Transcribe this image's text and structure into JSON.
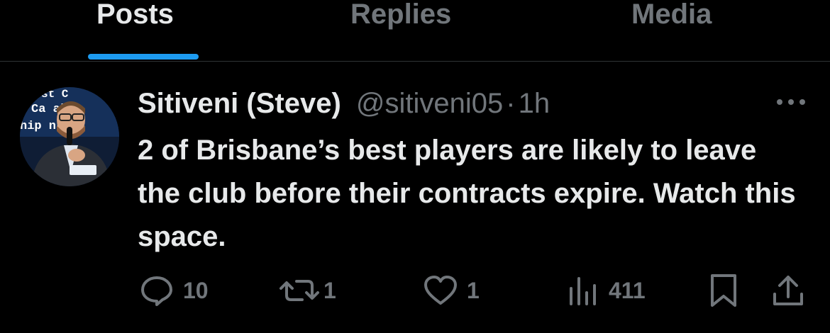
{
  "tabs": [
    {
      "label": "Posts",
      "active": true
    },
    {
      "label": "Replies",
      "active": false
    },
    {
      "label": "Media",
      "active": false
    }
  ],
  "colors": {
    "accent": "#1d9bf0",
    "background": "#000000",
    "text_primary": "#e7e9ea",
    "text_secondary": "#71767b"
  },
  "post": {
    "author_name": "Sitiveni (Steve)",
    "handle": "@sitiveni05",
    "separator": "·",
    "time": "1h",
    "text": "2 of Brisbane’s best players are likely to leave the club before their contracts expire. Watch this space.",
    "avatar": {
      "icon": "profile-photo-icon",
      "background_text_1": "st C",
      "background_text_2": "Ca al",
      "background_text_3": "hip nag"
    },
    "actions": {
      "reply_count": "10",
      "repost_count": "1",
      "like_count": "1",
      "views_count": "411"
    }
  }
}
